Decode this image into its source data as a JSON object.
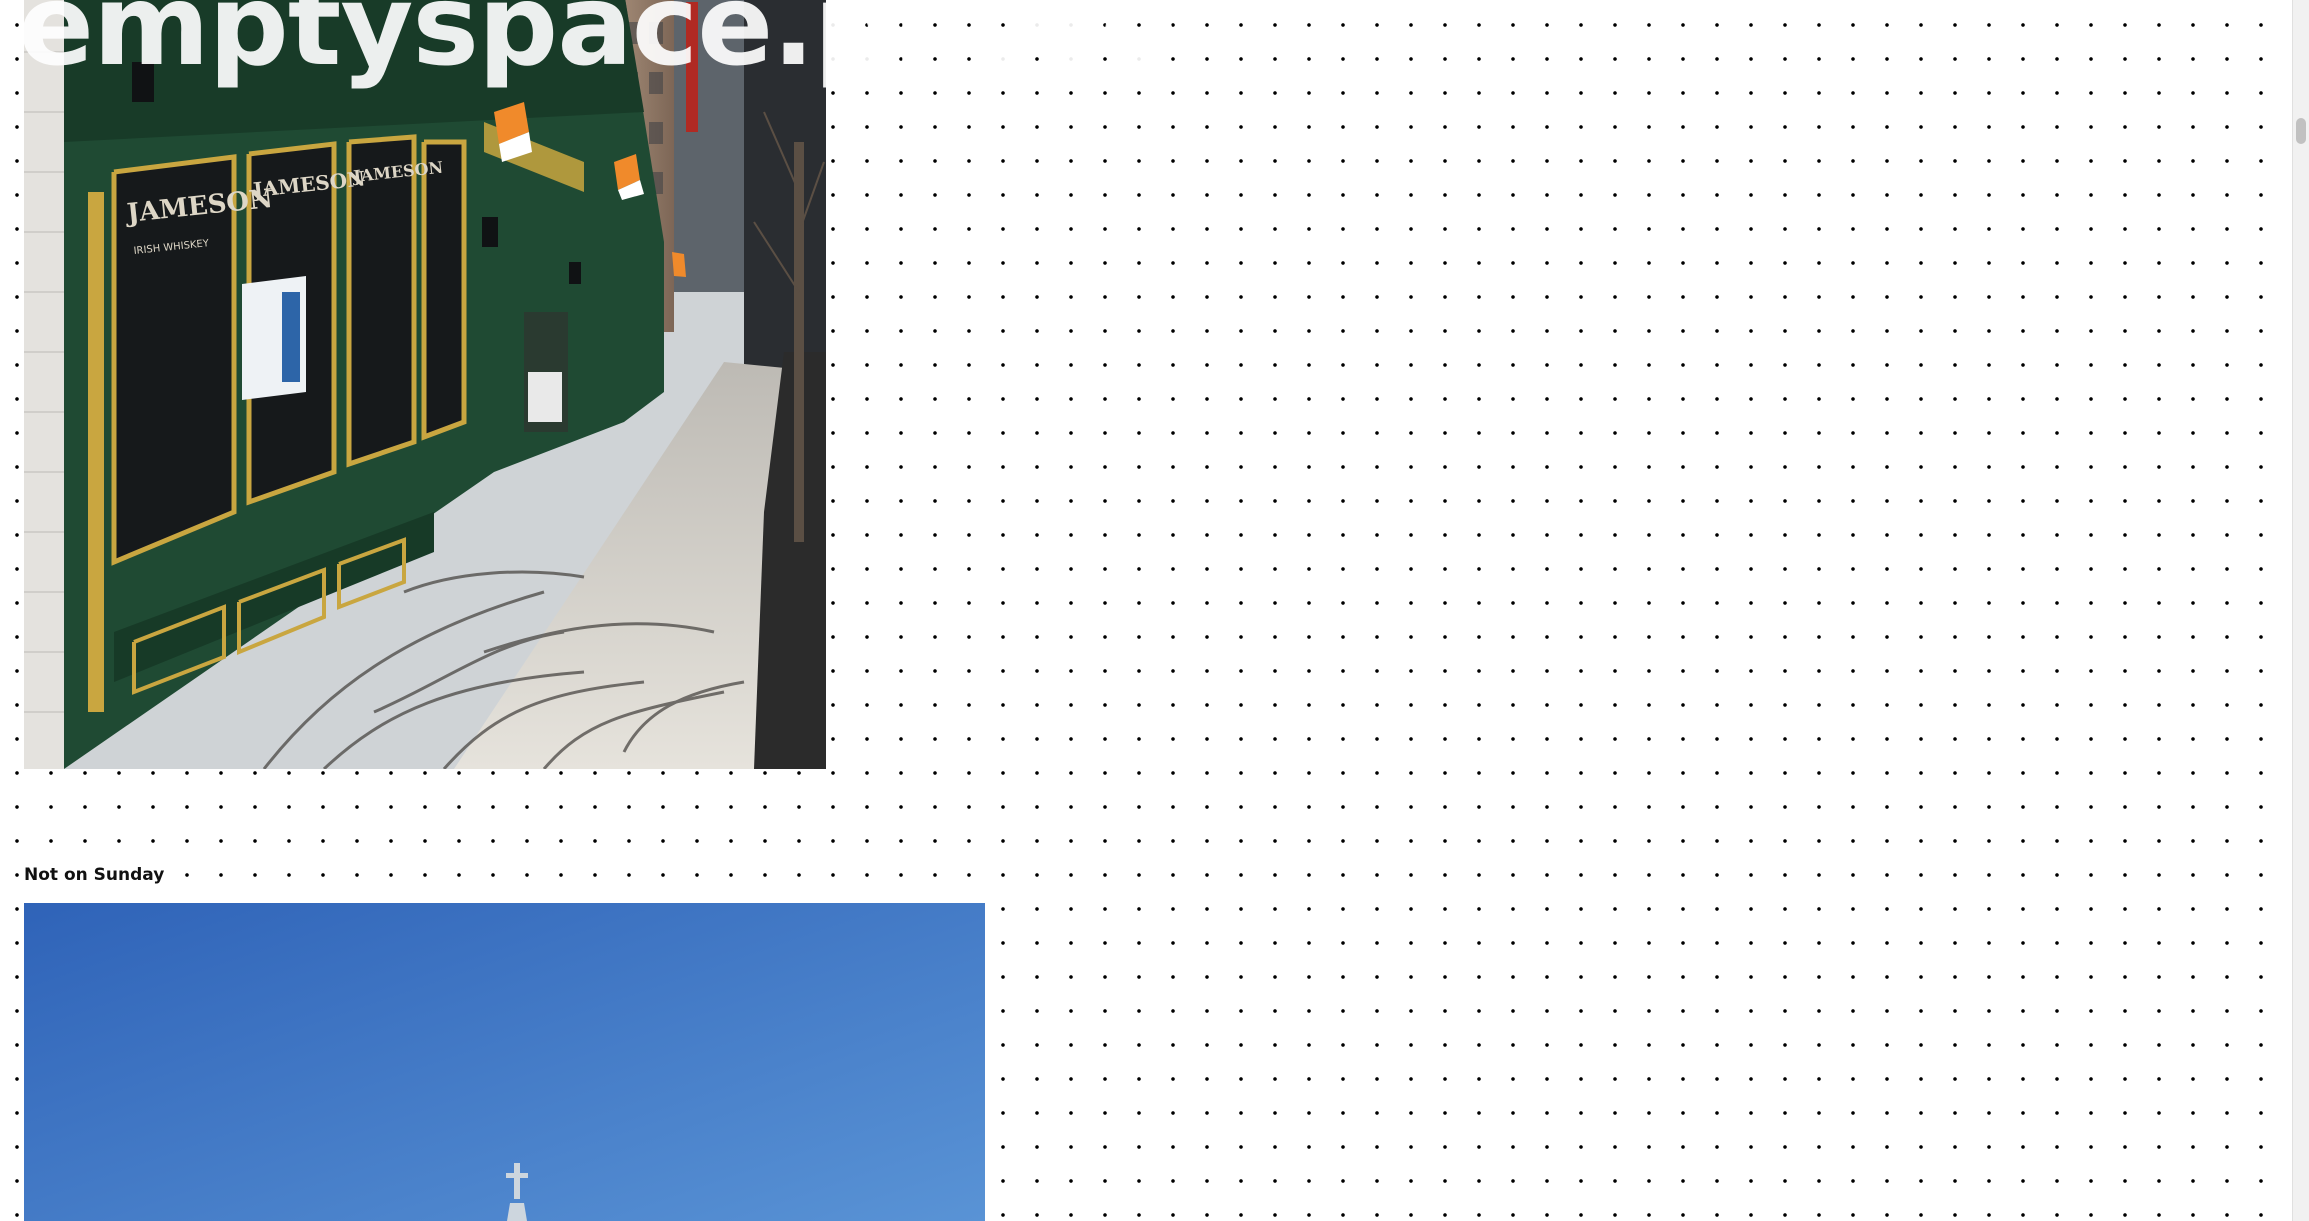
{
  "site": {
    "logo_text": "emptyspace.photo"
  },
  "posts": [
    {
      "image_alt": "Green storefront of an Irish pub on a sunny city sidewalk with orange and white flags and tree shadows",
      "storefront_window_text": "JAMESON",
      "storefront_sub_text": "IRISH WHISKEY"
    },
    {
      "caption": "Not on Sunday",
      "image_alt": "Clear blue sky above a church spire topped by a cross"
    }
  ],
  "colors": {
    "page_background": "#ffffff",
    "dot_grid": "#000000",
    "storefront_green": "#1f4a33",
    "gold_trim": "#c9a640",
    "sky_blue": "#3f79c8"
  }
}
